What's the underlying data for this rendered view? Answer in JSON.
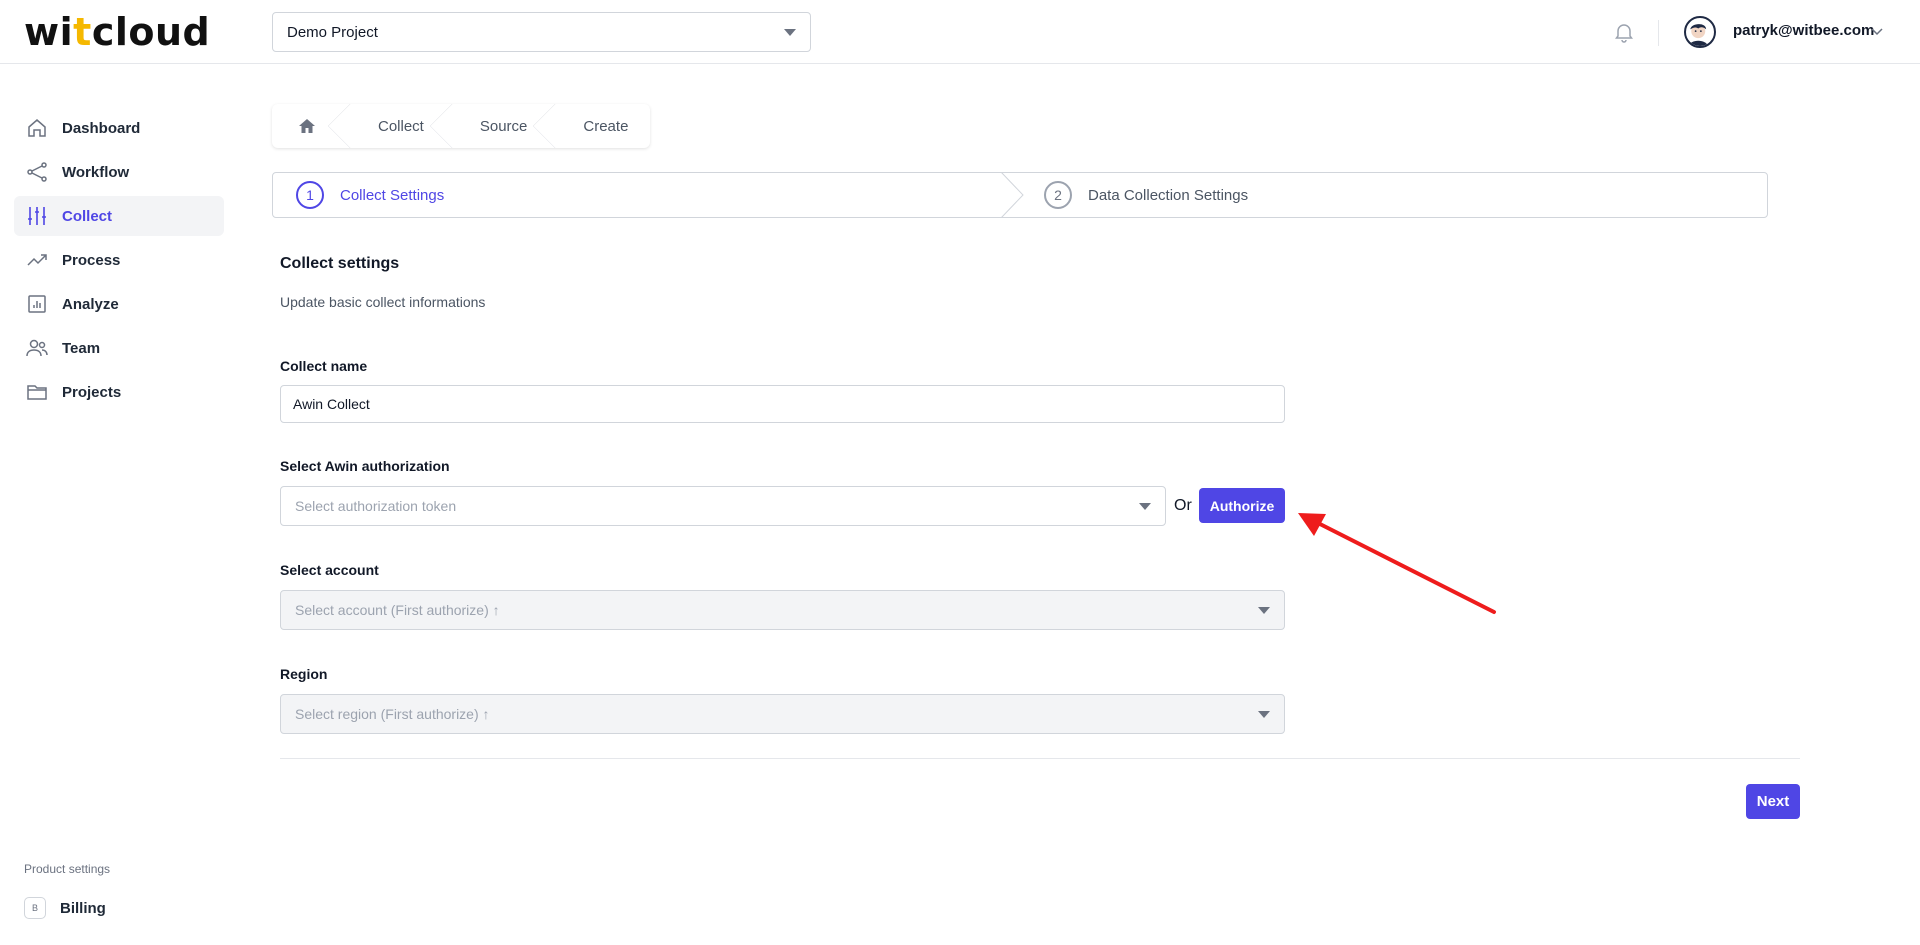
{
  "header": {
    "logo_part1": "wi",
    "logo_accent": "t",
    "logo_part2": "cloud",
    "project_select": "Demo Project",
    "user_email": "patryk@witbee.com"
  },
  "sidebar": {
    "items": [
      {
        "label": "Dashboard",
        "icon": "home-icon"
      },
      {
        "label": "Workflow",
        "icon": "share-nodes-icon"
      },
      {
        "label": "Collect",
        "icon": "sliders-icon",
        "active": true
      },
      {
        "label": "Process",
        "icon": "trend-up-icon"
      },
      {
        "label": "Analyze",
        "icon": "bar-chart-icon"
      },
      {
        "label": "Team",
        "icon": "users-icon"
      },
      {
        "label": "Projects",
        "icon": "folder-icon"
      }
    ],
    "product_settings": "Product settings",
    "billing_badge": "B",
    "billing_label": "Billing"
  },
  "breadcrumb": {
    "items": [
      "Collect",
      "Source",
      "Create"
    ]
  },
  "stepper": {
    "steps": [
      {
        "number": "1",
        "label": "Collect Settings",
        "active": true
      },
      {
        "number": "2",
        "label": "Data Collection Settings",
        "active": false
      }
    ]
  },
  "form": {
    "title": "Collect settings",
    "subtitle": "Update basic collect informations",
    "collect_name_label": "Collect name",
    "collect_name_value": "Awin Collect",
    "auth_label": "Select Awin authorization",
    "auth_placeholder": "Select authorization token",
    "or_text": "Or",
    "authorize_button": "Authorize",
    "account_label": "Select account",
    "account_placeholder": "Select account (First authorize) ↑",
    "region_label": "Region",
    "region_placeholder": "Select region (First authorize) ↑",
    "next_button": "Next"
  },
  "colors": {
    "accent": "#4f46e5",
    "annotation_arrow": "#ee1c1c",
    "logo_accent": "#f5b800"
  }
}
